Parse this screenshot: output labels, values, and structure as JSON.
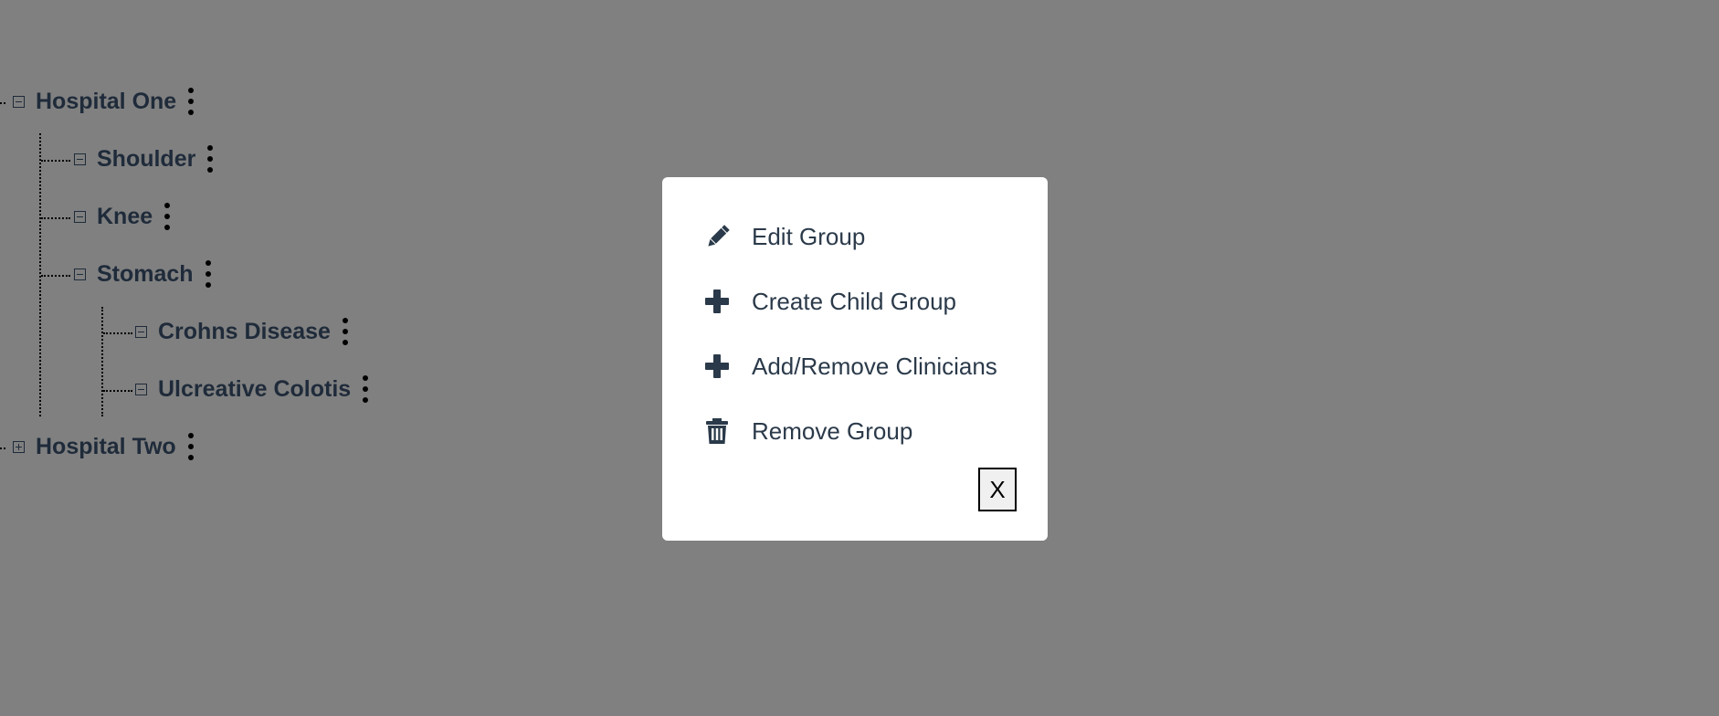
{
  "tree": {
    "nodes": [
      {
        "label": "Hospital One",
        "expanded": true
      },
      {
        "label": "Shoulder",
        "expanded": true
      },
      {
        "label": "Knee",
        "expanded": true
      },
      {
        "label": "Stomach",
        "expanded": true
      },
      {
        "label": "Crohns Disease",
        "expanded": true
      },
      {
        "label": "Ulcreative Colotis",
        "expanded": true
      },
      {
        "label": "Hospital Two",
        "expanded": false
      }
    ]
  },
  "modal": {
    "items": [
      {
        "label": "Edit Group",
        "icon": "pencil-icon"
      },
      {
        "label": "Create Child Group",
        "icon": "plus-icon"
      },
      {
        "label": "Add/Remove Clinicians",
        "icon": "plus-icon"
      },
      {
        "label": "Remove Group",
        "icon": "trash-icon"
      }
    ],
    "close_label": "X"
  },
  "colors": {
    "backdrop": "#808080",
    "text": "#1f2b3a",
    "modal_bg": "#ffffff"
  }
}
